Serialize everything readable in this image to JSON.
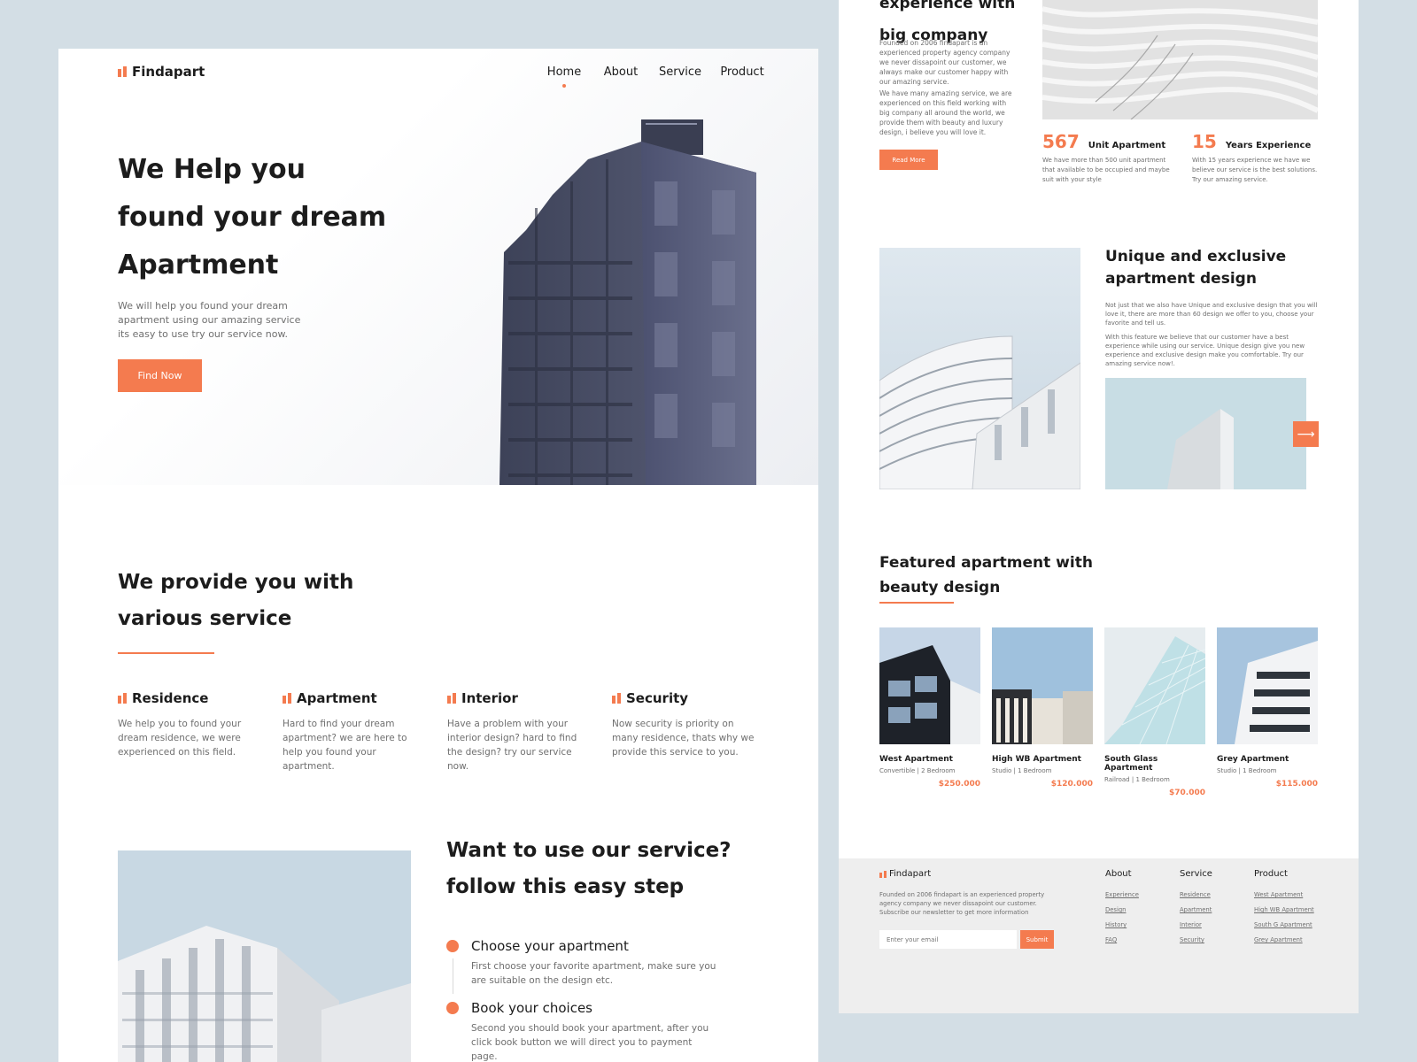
{
  "brand": {
    "name": "Findapart",
    "accent": "#f47b4f"
  },
  "nav": {
    "items": [
      {
        "label": "Home"
      },
      {
        "label": "About"
      },
      {
        "label": "Service"
      },
      {
        "label": "Product"
      }
    ]
  },
  "hero": {
    "title_l1": "We Help you",
    "title_l2": "found your dream",
    "title_l3": "Apartment",
    "desc": "We will help you found your dream apartment using our amazing service its easy to use try our service now.",
    "cta": "Find Now"
  },
  "services": {
    "title_l1": "We provide you with",
    "title_l2": "various service",
    "items": [
      {
        "name": "Residence",
        "desc": "We help you to found your dream residence, we were experienced on this field."
      },
      {
        "name": "Apartment",
        "desc": "Hard to find your dream apartment? we are here to help you found your apartment."
      },
      {
        "name": "Interior",
        "desc": "Have a problem with your interior design? hard to find the design? try our service now."
      },
      {
        "name": "Security",
        "desc": "Now security is priority on many residence, thats why we provide this service to you."
      }
    ]
  },
  "steps": {
    "title_l1": "Want to use our service?",
    "title_l2": "follow this easy step",
    "items": [
      {
        "name": "Choose your apartment",
        "desc": "First choose your favorite apartment, make sure you are suitable on the design etc."
      },
      {
        "name": "Book your choices",
        "desc": "Second you should book your apartment, after you click book button we will direct you to payment page."
      }
    ]
  },
  "experience": {
    "title_l1": "experience with",
    "title_l2": "big company",
    "p1": "Founded on 2006 findapart is an experienced property agency company we never dissapoint our customer, we always make our customer happy with our amazing service.",
    "p2": "We have many amazing service, we are experienced on this field working with big company all around the world, we provide them with beauty and luxury design, i believe you will love it.",
    "button": "Read More",
    "stats": [
      {
        "number": "567",
        "label": "Unit Apartment",
        "desc": "We have more than 500 unit apartment that available to be occupied and maybe suit with your style"
      },
      {
        "number": "15",
        "label": "Years Experience",
        "desc": "With 15 years experience we have we believe our service is  the best solutions. Try our amazing service."
      }
    ]
  },
  "unique": {
    "title_l1": "Unique and exclusive",
    "title_l2": "apartment design",
    "p1": "Not just that we also have Unique and exclusive design that you will love it, there are more than 60 design we offer to you, choose your favorite and tell us.",
    "p2": "With this feature we believe that our customer have a best experience while using our service. Unique design give you new experience and exclusive design make you comfortable. Try our amazing service now!."
  },
  "featured": {
    "title_l1": "Featured apartment with",
    "title_l2": "beauty design",
    "items": [
      {
        "name": "West Apartment",
        "meta": "Convertible | 2 Bedroom",
        "price": "$250.000"
      },
      {
        "name": "High WB Apartment",
        "meta": "Studio | 1 Bedroom",
        "price": "$120.000"
      },
      {
        "name": "South Glass Apartment",
        "meta": "Railroad | 1 Bedroom",
        "price": "$70.000"
      },
      {
        "name": "Grey Apartment",
        "meta": "Studio | 1 Bedroom",
        "price": "$115.000"
      }
    ]
  },
  "footer": {
    "brand": "Findapart",
    "desc": "Founded on 2006 findapart is an experienced property agency company we never dissapoint our customer. Subscribe our newsletter to get more information",
    "email_placeholder": "Enter your email",
    "submit": "Submit",
    "columns": [
      {
        "title": "About",
        "links": [
          "Experience",
          "Design",
          "History",
          "FAQ"
        ]
      },
      {
        "title": "Service",
        "links": [
          "Residence",
          "Apartment",
          "Interior",
          "Security"
        ]
      },
      {
        "title": "Product",
        "links": [
          "West Apartment",
          "High WB Apartment",
          "South G Apartment",
          "Grey Apartment"
        ]
      }
    ]
  }
}
